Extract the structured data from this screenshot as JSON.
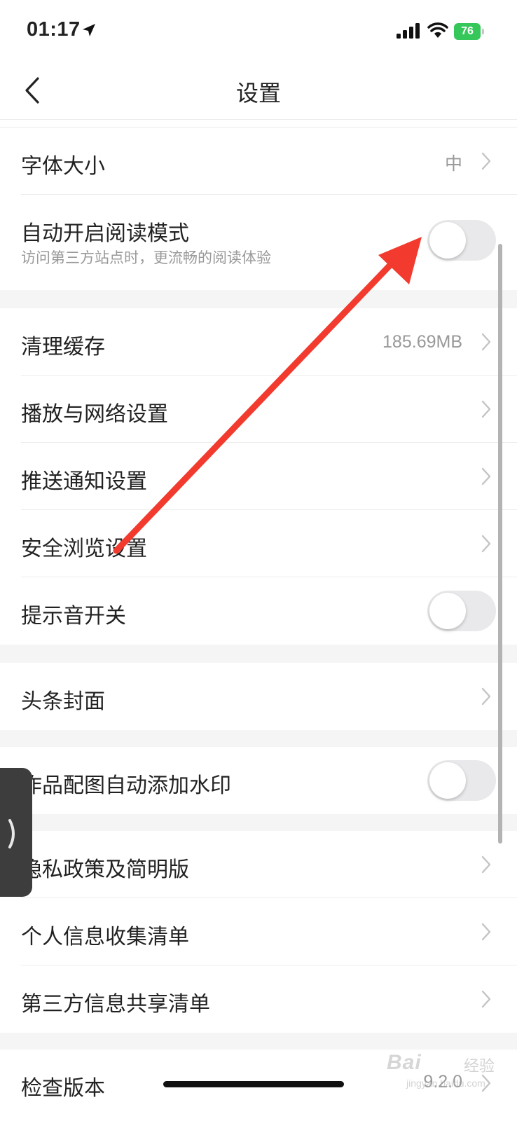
{
  "status_bar": {
    "time": "01:17",
    "battery": "76"
  },
  "nav": {
    "title": "设置"
  },
  "groups": [
    {
      "items": [
        {
          "label": "字体大小",
          "value": "中",
          "control": "chevron"
        },
        {
          "label": "自动开启阅读模式",
          "sublabel": "访问第三方站点时，更流畅的阅读体验",
          "control": "toggle",
          "toggle_on": false
        }
      ]
    },
    {
      "items": [
        {
          "label": "清理缓存",
          "value": "185.69MB",
          "control": "chevron"
        },
        {
          "label": "播放与网络设置",
          "control": "chevron"
        },
        {
          "label": "推送通知设置",
          "control": "chevron"
        },
        {
          "label": "安全浏览设置",
          "control": "chevron"
        },
        {
          "label": "提示音开关",
          "control": "toggle",
          "toggle_on": false
        }
      ]
    },
    {
      "items": [
        {
          "label": "头条封面",
          "control": "chevron"
        }
      ]
    },
    {
      "items": [
        {
          "label": "作品配图自动添加水印",
          "control": "toggle",
          "toggle_on": false
        }
      ]
    },
    {
      "items": [
        {
          "label": "隐私政策及简明版",
          "control": "chevron"
        },
        {
          "label": "个人信息收集清单",
          "control": "chevron"
        },
        {
          "label": "第三方信息共享清单",
          "control": "chevron"
        }
      ]
    },
    {
      "items": [
        {
          "label": "检查版本",
          "value": "9.2.0",
          "control": "chevron"
        }
      ]
    }
  ],
  "watermark": {
    "logo": "Bai",
    "suffix": "经验",
    "url": "jingyan.baidu.com"
  },
  "colors": {
    "annotation_arrow": "#f23a2e",
    "toggle_off": "#e9e9eb",
    "battery": "#35c759"
  },
  "icons": [
    "location-arrow-icon",
    "signal-bars-icon",
    "wifi-icon",
    "battery-icon",
    "back-chevron-icon",
    "chevron-right-icon",
    "floating-expand-icon"
  ]
}
